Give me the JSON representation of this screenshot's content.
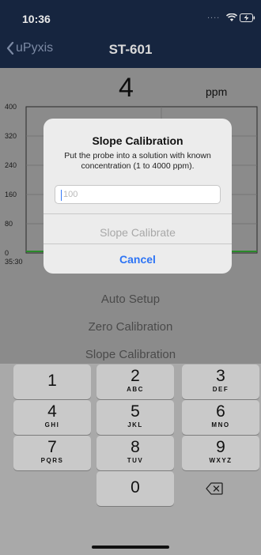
{
  "status_bar": {
    "time": "10:36",
    "dots": "....",
    "wifi_icon": "wifi-icon",
    "battery_icon": "battery-charging-icon"
  },
  "nav": {
    "back_label": "uPyxis",
    "title": "ST-601"
  },
  "reading": {
    "value": "4",
    "unit": "ppm"
  },
  "chart": {
    "y_ticks": [
      "400",
      "320",
      "240",
      "160",
      "80",
      "0"
    ],
    "x_tick": "35:30"
  },
  "menu": {
    "auto_setup": "Auto Setup",
    "zero_cal": "Zero Calibration",
    "slope_cal": "Slope Calibration"
  },
  "dialog": {
    "title": "Slope Calibration",
    "message": "Put the probe into a solution with known concentration (1 to 4000 ppm).",
    "input_placeholder": "100",
    "confirm_label": "Slope Calibrate",
    "cancel_label": "Cancel"
  },
  "keyboard": {
    "keys": [
      {
        "num": "1",
        "letters": ""
      },
      {
        "num": "2",
        "letters": "ABC"
      },
      {
        "num": "3",
        "letters": "DEF"
      },
      {
        "num": "4",
        "letters": "GHI"
      },
      {
        "num": "5",
        "letters": "JKL"
      },
      {
        "num": "6",
        "letters": "MNO"
      },
      {
        "num": "7",
        "letters": "PQRS"
      },
      {
        "num": "8",
        "letters": "TUV"
      },
      {
        "num": "9",
        "letters": "WXYZ"
      },
      {
        "num": "0",
        "letters": ""
      }
    ],
    "delete_icon": "backspace-icon"
  },
  "colors": {
    "nav_bg": "#16253f",
    "accent_blue": "#2d74f5",
    "chart_line": "#2a8a2a"
  }
}
